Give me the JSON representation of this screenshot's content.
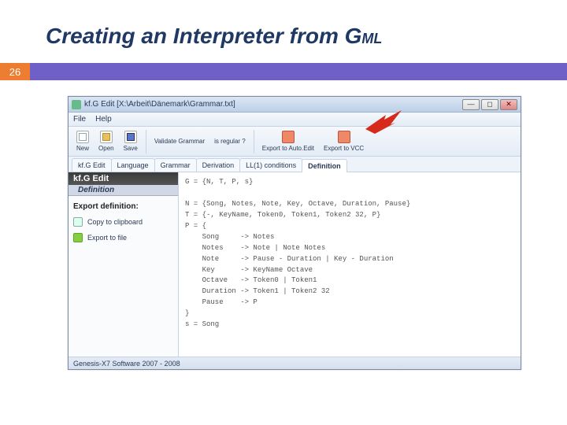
{
  "slide": {
    "title_main": "Creating an Interpreter from G",
    "title_sub": "ML",
    "page_number": "26"
  },
  "window": {
    "title": "kf.G Edit  [X:\\Arbeit\\Dänemark\\Grammar.txt]",
    "menu": {
      "file": "File",
      "help": "Help"
    },
    "toolbar": {
      "new": "New",
      "open": "Open",
      "save": "Save",
      "validate": "Validate Grammar",
      "regular": "is regular ?",
      "export_auto": "Export to Auto.Edit",
      "export_vcc": "Export to VCC"
    },
    "tabs": {
      "t0": "kf.G Edit",
      "t1": "Language",
      "t2": "Grammar",
      "t3": "Derivation",
      "t4": "LL(1) conditions",
      "t5": "Definition"
    },
    "sidebar": {
      "head": "kf.G Edit",
      "sub": "Definition",
      "section": "Export definition:",
      "copy": "Copy to clipboard",
      "export": "Export to file"
    },
    "grammar": {
      "l0": "G = {N, T, P, s}",
      "l1": "",
      "l2": "N = {Song, Notes, Note, Key, Octave, Duration, Pause}",
      "l3": "T = {-, KeyName, Token0, Token1, Token2 32, P}",
      "l4": "P = {",
      "l5": "    Song     -> Notes",
      "l6": "    Notes    -> Note | Note Notes",
      "l7": "    Note     -> Pause - Duration | Key - Duration",
      "l8": "    Key      -> KeyName Octave",
      "l9": "    Octave   -> Token0 | Token1",
      "l10": "    Duration -> Token1 | Token2 32",
      "l11": "    Pause    -> P",
      "l12": "}",
      "l13": "s = Song"
    },
    "status": "Genesis-X7 Software 2007 - 2008"
  }
}
